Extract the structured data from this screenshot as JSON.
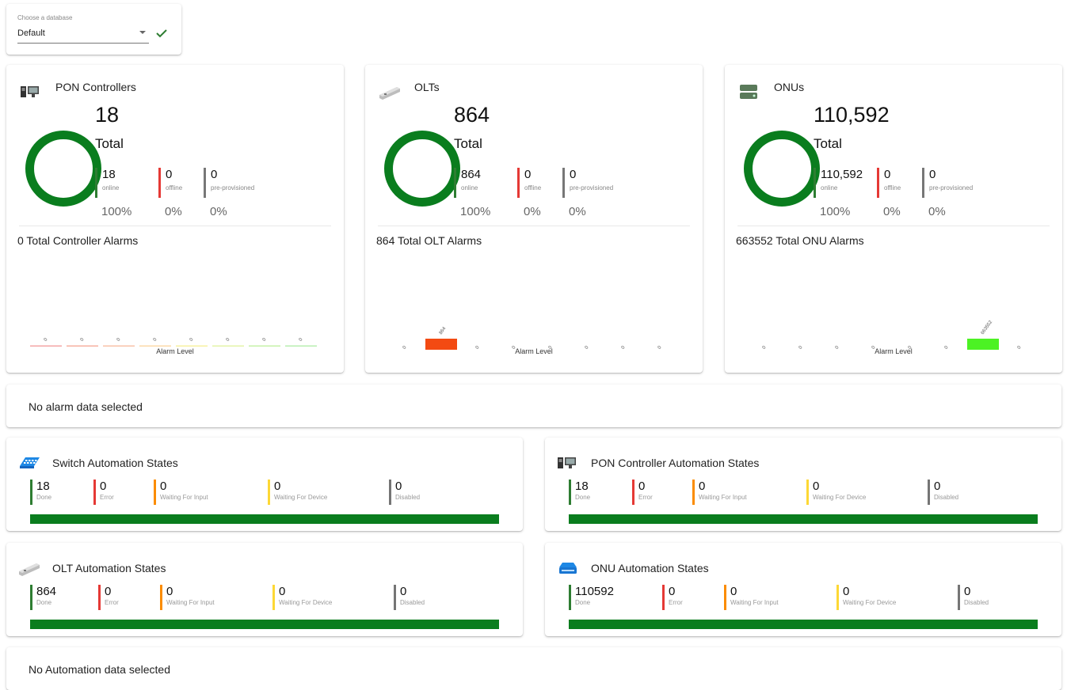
{
  "database": {
    "label": "Choose a database",
    "value": "Default"
  },
  "colors": {
    "online": "#2e7d32",
    "offline": "#e53935",
    "preprov": "#777777",
    "done": "#2e7d32",
    "error": "#e53935",
    "waiting_input": "#fb8c00",
    "waiting_device": "#fdd835",
    "disabled": "#757575",
    "progress": "#0a7d1e"
  },
  "alarm_levels": [
    "Emergency",
    "Alert",
    "Critical",
    "Error",
    "Warning",
    "Notice",
    "Info",
    "Debug"
  ],
  "alarm_axis_label": "Alarm Level",
  "devices": [
    {
      "title": "PON Controllers",
      "icon": "pon-controller-icon",
      "total": "18",
      "total_label": "Total",
      "stats": [
        {
          "value": "18",
          "label": "online",
          "pct": "100%"
        },
        {
          "value": "0",
          "label": "offline",
          "pct": "0%"
        },
        {
          "value": "0",
          "label": "pre-provisioned",
          "pct": "0%"
        }
      ],
      "alarm_title": "0 Total Controller Alarms",
      "alarm_values": [
        0,
        0,
        0,
        0,
        0,
        0,
        0,
        0
      ]
    },
    {
      "title": "OLTs",
      "icon": "olt-icon",
      "total": "864",
      "total_label": "Total",
      "stats": [
        {
          "value": "864",
          "label": "online",
          "pct": "100%"
        },
        {
          "value": "0",
          "label": "offline",
          "pct": "0%"
        },
        {
          "value": "0",
          "label": "pre-provisioned",
          "pct": "0%"
        }
      ],
      "alarm_title": "864 Total OLT Alarms",
      "alarm_values": [
        0,
        864,
        0,
        0,
        0,
        0,
        0,
        0
      ]
    },
    {
      "title": "ONUs",
      "icon": "onu-icon",
      "total": "110,592",
      "total_label": "Total",
      "stats": [
        {
          "value": "110,592",
          "label": "online",
          "pct": "100%"
        },
        {
          "value": "0",
          "label": "offline",
          "pct": "0%"
        },
        {
          "value": "0",
          "label": "pre-provisioned",
          "pct": "0%"
        }
      ],
      "alarm_title": "663552 Total ONU Alarms",
      "alarm_values": [
        0,
        0,
        0,
        0,
        0,
        0,
        663552,
        0
      ]
    }
  ],
  "alarm_message": "No alarm data selected",
  "automation": [
    {
      "title": "Switch Automation States",
      "icon": "switch-icon",
      "states": [
        {
          "value": "18",
          "label": "Done"
        },
        {
          "value": "0",
          "label": "Error"
        },
        {
          "value": "0",
          "label": "Waiting For Input"
        },
        {
          "value": "0",
          "label": "Waiting For Device"
        },
        {
          "value": "0",
          "label": "Disabled"
        }
      ],
      "done_fraction": 1.0
    },
    {
      "title": "PON Controller Automation States",
      "icon": "pon-controller-icon",
      "states": [
        {
          "value": "18",
          "label": "Done"
        },
        {
          "value": "0",
          "label": "Error"
        },
        {
          "value": "0",
          "label": "Waiting For Input"
        },
        {
          "value": "0",
          "label": "Waiting For Device"
        },
        {
          "value": "0",
          "label": "Disabled"
        }
      ],
      "done_fraction": 1.0
    },
    {
      "title": "OLT Automation States",
      "icon": "olt-icon",
      "states": [
        {
          "value": "864",
          "label": "Done"
        },
        {
          "value": "0",
          "label": "Error"
        },
        {
          "value": "0",
          "label": "Waiting For Input"
        },
        {
          "value": "0",
          "label": "Waiting For Device"
        },
        {
          "value": "0",
          "label": "Disabled"
        }
      ],
      "done_fraction": 1.0
    },
    {
      "title": "ONU Automation States",
      "icon": "onu-automation-icon",
      "states": [
        {
          "value": "110592",
          "label": "Done"
        },
        {
          "value": "0",
          "label": "Error"
        },
        {
          "value": "0",
          "label": "Waiting For Input"
        },
        {
          "value": "0",
          "label": "Waiting For Device"
        },
        {
          "value": "0",
          "label": "Disabled"
        }
      ],
      "done_fraction": 1.0
    }
  ],
  "automation_message": "No Automation data selected"
}
